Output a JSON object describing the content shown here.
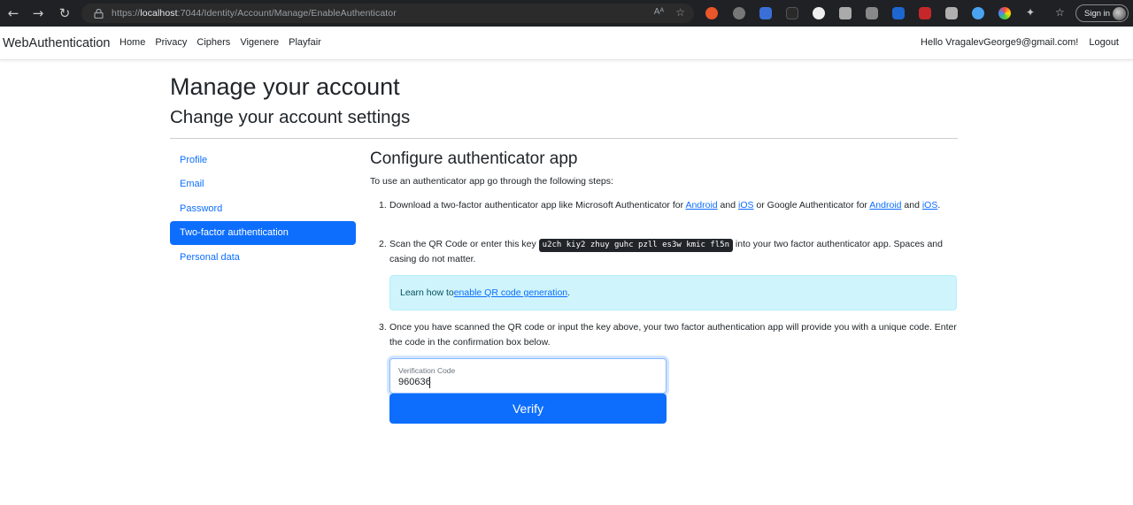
{
  "browser": {
    "url_prefix": "https://",
    "url_host": "localhost",
    "url_rest": ":7044/Identity/Account/Manage/EnableAuthenticator",
    "reader_label": "Aᴬ",
    "signin_label": "Sign in"
  },
  "navbar": {
    "brand": "WebAuthentication",
    "links": [
      "Home",
      "Privacy",
      "Ciphers",
      "Vigenere",
      "Playfair"
    ],
    "greeting": "Hello VragalevGeorge9@gmail.com!",
    "logout": "Logout"
  },
  "page": {
    "title": "Manage your account",
    "subtitle": "Change your account settings"
  },
  "sidenav": {
    "items": [
      "Profile",
      "Email",
      "Password",
      "Two-factor authentication",
      "Personal data"
    ],
    "active_index": 3
  },
  "main": {
    "heading": "Configure authenticator app",
    "intro": "To use an authenticator app go through the following steps:",
    "step1": {
      "num": "1.",
      "part1": "Download a two-factor authenticator app like Microsoft Authenticator for ",
      "link1": "Android",
      "part2": " and ",
      "link2": "iOS",
      "part3": " or Google Authenticator for ",
      "link3": "Android",
      "part4": " and ",
      "link4": "iOS",
      "part5": "."
    },
    "step2": {
      "num": "2.",
      "part1": "Scan the QR Code or enter this key ",
      "key": "u2ch kiy2 zhuy guhc pzll es3w kmic fl5n",
      "part2": " into your two factor authenticator app. Spaces and casing do not matter."
    },
    "alert": {
      "text": "Learn how to ",
      "link": "enable QR code generation",
      "end": "."
    },
    "step3": {
      "num": "3.",
      "text": "Once you have scanned the QR code or input the key above, your two factor authentication app will provide you with a unique code. Enter the code in the confirmation box below."
    },
    "verification": {
      "label": "Verification Code",
      "value": "960636"
    },
    "verify_button": "Verify"
  }
}
